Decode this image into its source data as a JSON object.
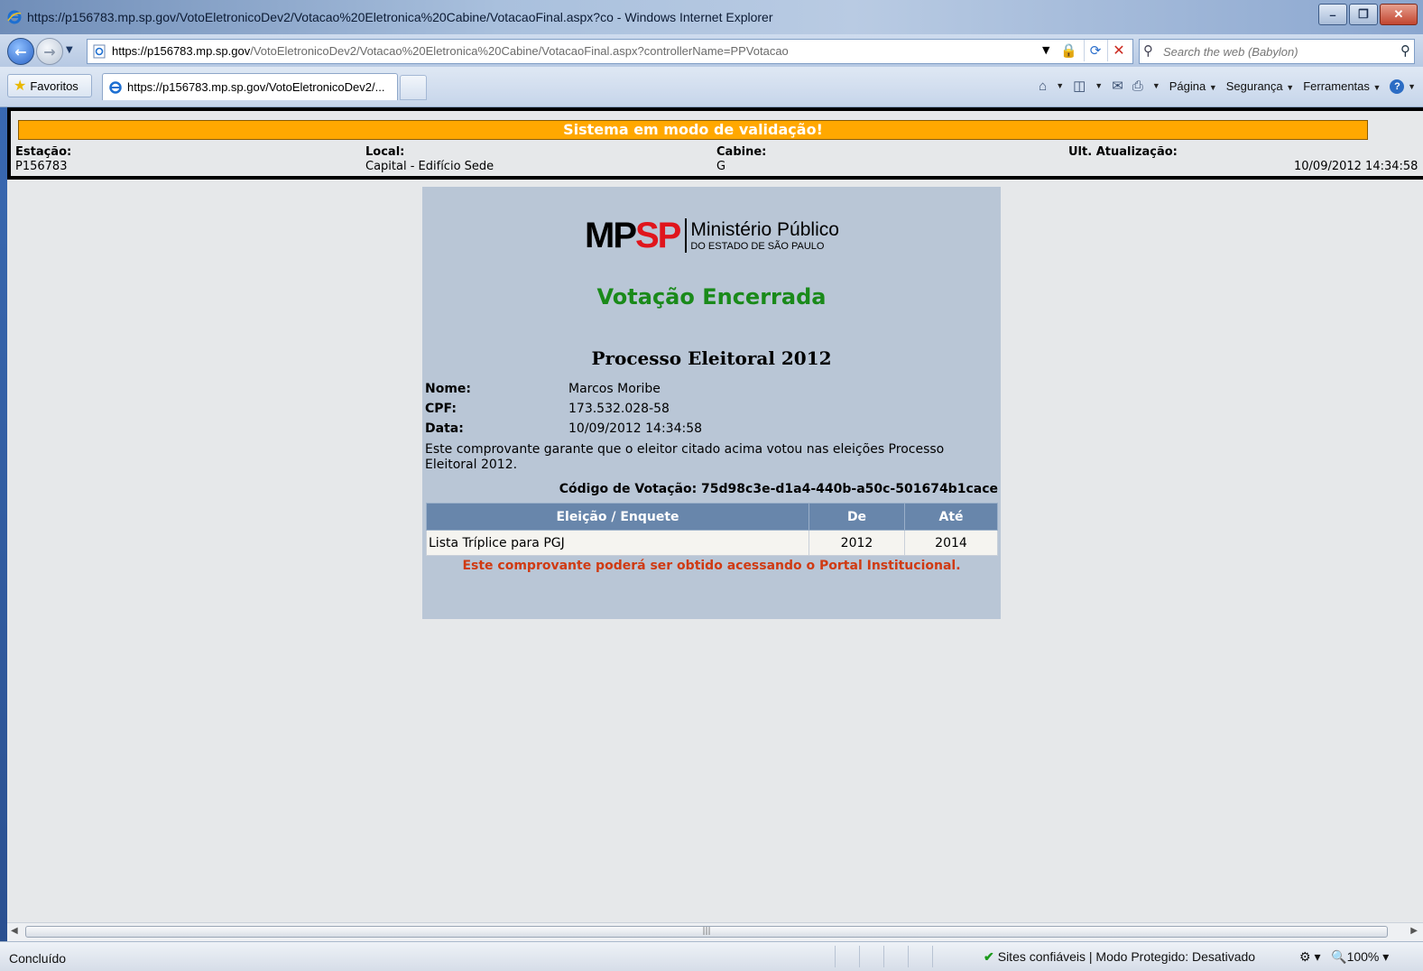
{
  "window": {
    "title": "https://p156783.mp.sp.gov/VotoEletronicoDev2/Votacao%20Eletronica%20Cabine/VotacaoFinal.aspx?co - Windows Internet Explorer"
  },
  "address_bar": {
    "url_host": "https://p156783.mp.sp.gov",
    "url_path": "/VotoEletronicoDev2/Votacao%20Eletronica%20Cabine/VotacaoFinal.aspx?controllerName=PPVotacao"
  },
  "search": {
    "placeholder": "Search the web (Babylon)"
  },
  "tabs": {
    "favorites_label": "Favoritos",
    "active_tab": "https://p156783.mp.sp.gov/VotoEletronicoDev2/..."
  },
  "command_bar": {
    "page_menu": "Página",
    "security_menu": "Segurança",
    "tools_menu": "Ferramentas"
  },
  "header": {
    "validation_banner": "Sistema em modo de validação!",
    "station_label": "Estação:",
    "station_value": "P156783",
    "location_label": "Local:",
    "location_value": "Capital - Edifício Sede",
    "booth_label": "Cabine:",
    "booth_value": "G",
    "last_update_label": "Ult. Atualização:",
    "last_update_value": "10/09/2012 14:34:58"
  },
  "receipt": {
    "logo_letters_1": "MP",
    "logo_letters_2": "SP",
    "logo_line_1": "Ministério Público",
    "logo_line_2": "DO ESTADO DE SÃO PAULO",
    "status_title": "Votação Encerrada",
    "process_title": "Processo Eleitoral 2012",
    "name_label": "Nome:",
    "name_value": "Marcos Moribe",
    "cpf_label": "CPF:",
    "cpf_value": "173.532.028-58",
    "date_label": "Data:",
    "date_value": "10/09/2012 14:34:58",
    "statement": "Este comprovante garante que o eleitor citado acima votou nas eleições Processo Eleitoral 2012.",
    "vote_code": "Código de Votação: 75d98c3e-d1a4-440b-a50c-501674b1cace",
    "table": {
      "headers": [
        "Eleição / Enquete",
        "De",
        "Até"
      ],
      "rows": [
        [
          "Lista Tríplice para PGJ",
          "2012",
          "2014"
        ]
      ]
    },
    "note": "Este comprovante poderá ser obtido acessando o Portal Institucional."
  },
  "status_bar": {
    "status": "Concluído",
    "zone": "Sites confiáveis | Modo Protegido: Desativado",
    "zoom": "100%"
  }
}
